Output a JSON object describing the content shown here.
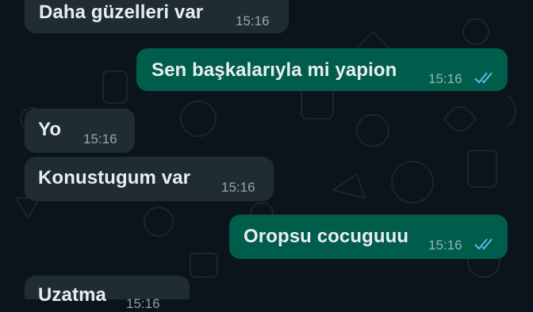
{
  "chat": {
    "messages": [
      {
        "direction": "incoming",
        "text": "Daha güzelleri var",
        "time": "15:16"
      },
      {
        "direction": "outgoing",
        "text": "Sen başkalarıyla mi yapion",
        "time": "15:16",
        "status": "read"
      },
      {
        "direction": "incoming",
        "text": "Yo",
        "time": "15:16"
      },
      {
        "direction": "incoming",
        "text": "Konustugum var",
        "time": "15:16"
      },
      {
        "direction": "outgoing",
        "text": "Oropsu cocuguuu",
        "time": "15:16",
        "status": "read"
      },
      {
        "direction": "incoming",
        "text": "Uzatma",
        "time": "15:16"
      }
    ]
  },
  "colors": {
    "background": "#0b141a",
    "incoming_bubble": "#1f2c34",
    "outgoing_bubble": "#005c4b",
    "read_ticks": "#53bdeb"
  },
  "icons": {
    "read_receipt": "double-check-icon"
  }
}
